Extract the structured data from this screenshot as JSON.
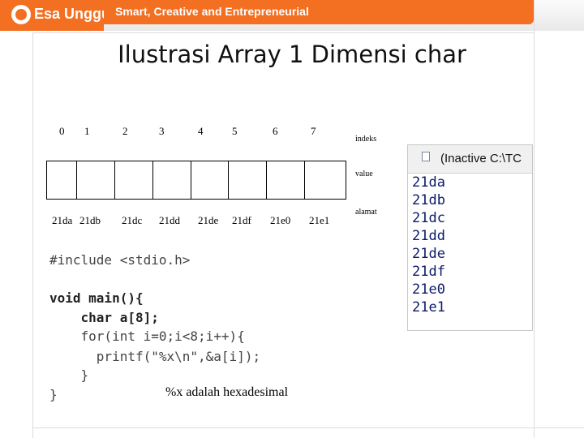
{
  "header": {
    "logo_text": "Esa Unggul",
    "tagline": "Smart, Creative and Entrepreneurial"
  },
  "title": "Ilustrasi Array 1 Dimensi char",
  "array": {
    "indices": [
      "0",
      "1",
      "2",
      "3",
      "4",
      "5",
      "6",
      "7"
    ],
    "addresses": [
      "21da",
      "21db",
      "21dc",
      "21dd",
      "21de",
      "21df",
      "21e0",
      "21e1"
    ],
    "label_indeks": "indeks",
    "label_value": "value",
    "label_alamat": "alamat"
  },
  "code": {
    "lines": [
      "#include <stdio.h>",
      "void main(){",
      "    char a[8];",
      "    for(int i=0;i<8;i++){",
      "      printf(\"%x\\n\",&a[i]);",
      "    }",
      "}"
    ],
    "note": "%x adalah hexadesimal"
  },
  "console": {
    "title": "(Inactive C:\\TC",
    "lines": [
      "21da",
      "21db",
      "21dc",
      "21dd",
      "21de",
      "21df",
      "21e0",
      "21e1"
    ]
  },
  "colors": {
    "brand_orange": "#f36f21",
    "console_text": "#0a1a6a"
  }
}
